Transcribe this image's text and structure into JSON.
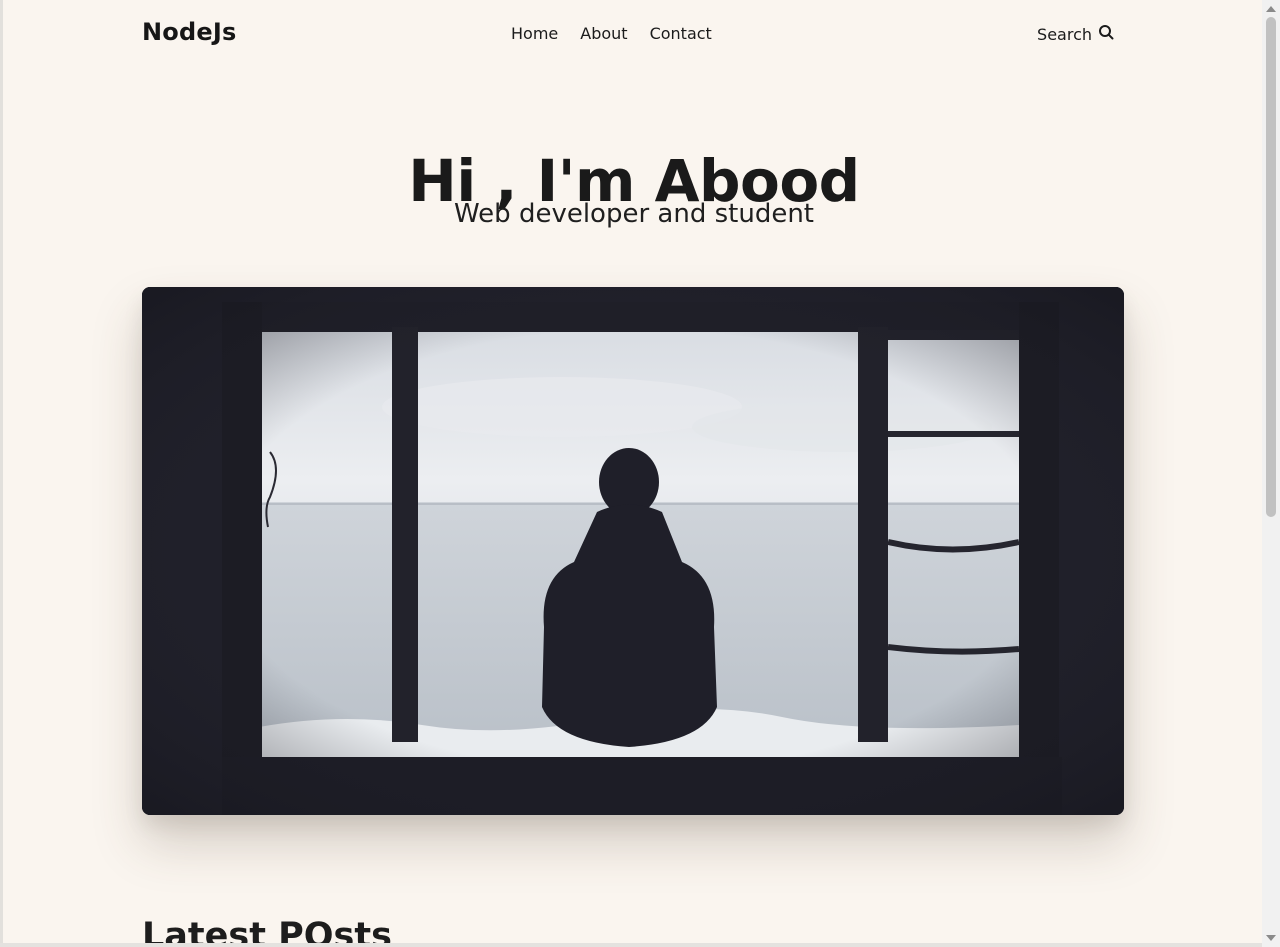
{
  "header": {
    "logo": "NodeJs",
    "nav": [
      {
        "label": "Home"
      },
      {
        "label": "About"
      },
      {
        "label": "Contact"
      }
    ],
    "search_label": "Search",
    "search_icon": "search-icon"
  },
  "hero": {
    "title": "Hi , I'm Abood",
    "subtitle": "Web developer and student"
  },
  "latest": {
    "title": "Latest POsts"
  },
  "colors": {
    "background": "#faf5ef",
    "text": "#1a1a1a"
  }
}
